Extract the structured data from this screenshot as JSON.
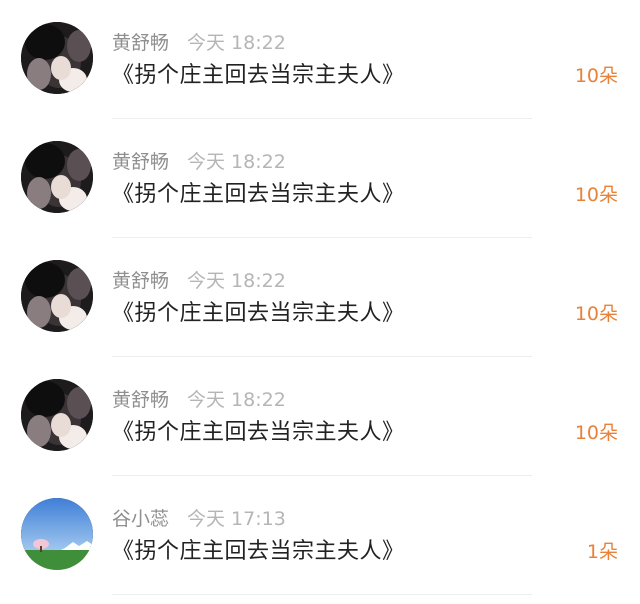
{
  "gift_list": [
    {
      "user_name": "黄舒畅",
      "time": "今天 18:22",
      "book_title": "《拐个庄主回去当宗主夫人》",
      "count": "10朵",
      "avatar": "portrait-avatar"
    },
    {
      "user_name": "黄舒畅",
      "time": "今天 18:22",
      "book_title": "《拐个庄主回去当宗主夫人》",
      "count": "10朵",
      "avatar": "portrait-avatar"
    },
    {
      "user_name": "黄舒畅",
      "time": "今天 18:22",
      "book_title": "《拐个庄主回去当宗主夫人》",
      "count": "10朵",
      "avatar": "portrait-avatar"
    },
    {
      "user_name": "黄舒畅",
      "time": "今天 18:22",
      "book_title": "《拐个庄主回去当宗主夫人》",
      "count": "10朵",
      "avatar": "portrait-avatar"
    },
    {
      "user_name": "谷小蕊",
      "time": "今天 17:13",
      "book_title": "《拐个庄主回去当宗主夫人》",
      "count": "1朵",
      "avatar": "landscape-avatar"
    }
  ],
  "colors": {
    "name": "#8f8f8f",
    "time": "#b5b5b5",
    "title": "#222222",
    "count": "#e8823a",
    "divider": "#eeeeee"
  }
}
